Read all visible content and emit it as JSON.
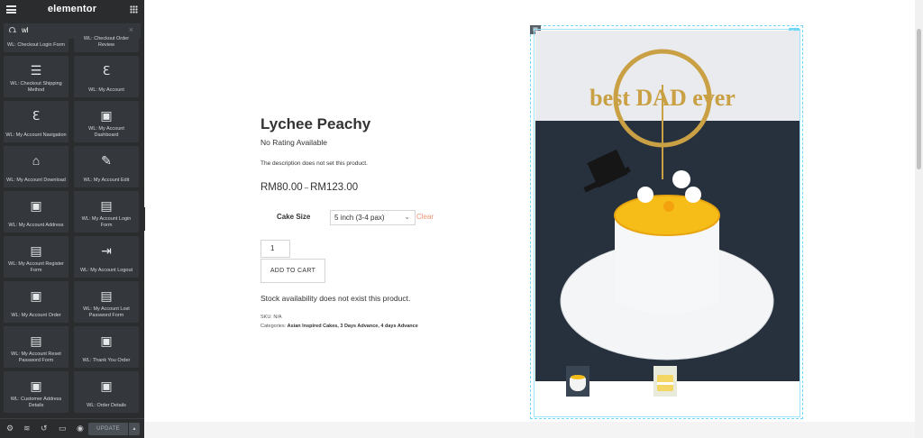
{
  "sidebar": {
    "brand": "elementor",
    "search_value": "wl",
    "widgets": [
      {
        "label": "WL: Checkout Login Form",
        "icon": "checkout-login-icon"
      },
      {
        "label": "WL: Checkout Order Review",
        "icon": "order-review-icon"
      },
      {
        "label": "WL: Checkout Shipping Method",
        "icon": "list-icon"
      },
      {
        "label": "WL: My Account",
        "icon": "elementor-icon"
      },
      {
        "label": "WL: My Account Navigation",
        "icon": "elementor-icon"
      },
      {
        "label": "WL: My Account Dashboard",
        "icon": "woo-icon"
      },
      {
        "label": "WL: My Account Download",
        "icon": "download-box-icon"
      },
      {
        "label": "WL: My Account Edit",
        "icon": "pencil-icon"
      },
      {
        "label": "WL: My Account Address",
        "icon": "woo-icon"
      },
      {
        "label": "WL: My Account Login Form",
        "icon": "form-window-icon"
      },
      {
        "label": "WL: My Account Register Form",
        "icon": "form-window-icon"
      },
      {
        "label": "WL: My Account Logout",
        "icon": "logout-icon"
      },
      {
        "label": "WL: My Account Order",
        "icon": "woo-icon"
      },
      {
        "label": "WL: My Account Lost Password Form",
        "icon": "form-window-icon"
      },
      {
        "label": "WL: My Account Reset Password Form",
        "icon": "form-window-icon"
      },
      {
        "label": "WL: Thank You Order",
        "icon": "woo-icon"
      },
      {
        "label": "WL: Customer Address Details",
        "icon": "woo-icon"
      },
      {
        "label": "WL: Order Details",
        "icon": "woo-icon"
      }
    ],
    "footer": {
      "update_label": "UPDATE",
      "icons": [
        "settings-icon",
        "layers-icon",
        "history-icon",
        "responsive-icon",
        "preview-eye-icon"
      ]
    }
  },
  "product": {
    "title": "Lychee Peachy",
    "rating_text": "No Rating Available",
    "description": "The description does not set this product.",
    "price_min": "RM80.00",
    "price_sep": "–",
    "price_max": "RM123.00",
    "size_label": "Cake Size",
    "size_value": "5 inch (3-4 pax)",
    "clear_label": "Clear",
    "quantity": "1",
    "add_to_cart_label": "ADD TO CART",
    "stock_text": "Stock availability does not exist this product.",
    "sku_text": "SKU: N/A",
    "categories_label": "Categories:",
    "categories_value": "Asian Inspired Cakes, 3 Days Advance, 4 days Advance",
    "topper_text": "best DAD ever",
    "image_colors": {
      "wall": "#e9ebee",
      "backdrop": "#27313d",
      "cake": "#f4f5f6",
      "glaze": "#f6bd18",
      "topper_gold": "#caa044",
      "hat": "#161616"
    }
  }
}
